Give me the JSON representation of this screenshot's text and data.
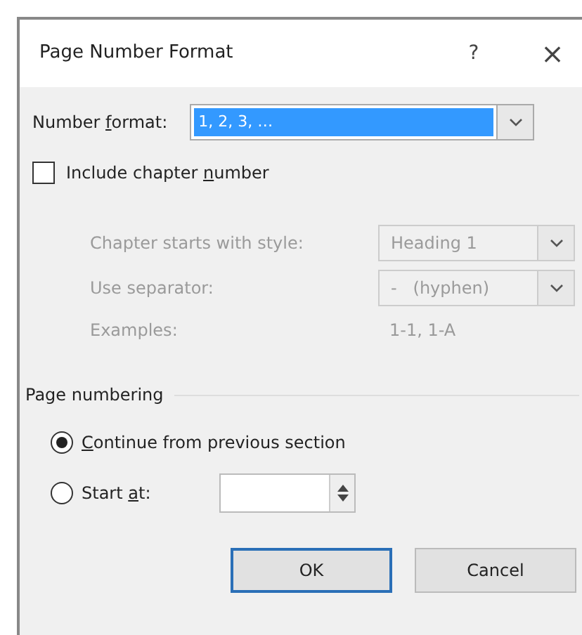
{
  "window": {
    "title": "Page Number Format",
    "help": "?",
    "close": "×"
  },
  "number_format": {
    "label": {
      "before": "Number ",
      "key": "f",
      "after": "ormat:"
    },
    "value": "1, 2, 3, …",
    "selected": true
  },
  "include_chapter": {
    "label": {
      "before": "Include chapter ",
      "key": "n",
      "after": "umber"
    },
    "checked": false
  },
  "chapter_options": {
    "disabled": true,
    "style": {
      "label": "Chapter starts with style:",
      "value": "Heading 1"
    },
    "separator": {
      "label": "Use separator:",
      "value": "-   (hyphen)"
    },
    "examples": {
      "label": "Examples:",
      "value": "1-1, 1-A"
    }
  },
  "page_numbering": {
    "title": "Page numbering",
    "options": [
      {
        "kind": "plain",
        "label": {
          "key": "C",
          "after": "ontinue from previous section"
        },
        "selected": true
      },
      {
        "kind": "spinner",
        "label": {
          "before": "Start ",
          "key": "a",
          "after": "t:"
        },
        "selected": false
      }
    ]
  },
  "buttons": [
    {
      "label": "OK",
      "default": true
    },
    {
      "label": "Cancel",
      "default": false
    }
  ]
}
